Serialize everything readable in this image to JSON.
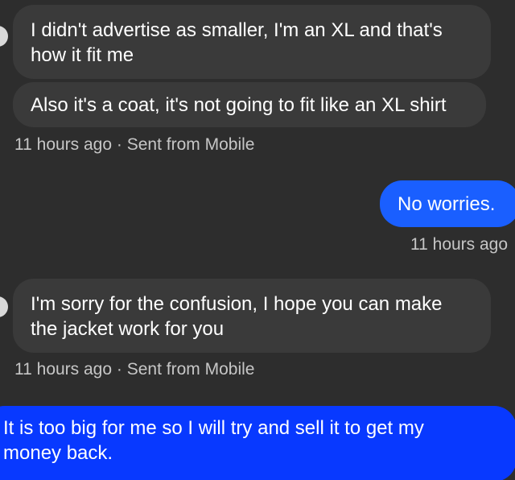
{
  "thread": {
    "messages": [
      {
        "direction": "incoming",
        "text": "I didn't advertise as smaller, I'm an XL and that's how it fit me"
      },
      {
        "direction": "incoming",
        "text": "Also it's a coat, it's not going to fit like an XL shirt"
      },
      {
        "direction": "incoming_meta",
        "time": "11 hours ago",
        "sep": "·",
        "source": "Sent from Mobile"
      },
      {
        "direction": "outgoing",
        "text": "No worries."
      },
      {
        "direction": "outgoing_meta",
        "time": "11 hours ago"
      },
      {
        "direction": "incoming",
        "text": "I'm sorry for the confusion, I hope you can make the jacket work for you"
      },
      {
        "direction": "incoming_meta",
        "time": "11 hours ago",
        "sep": "·",
        "source": "Sent from Mobile"
      },
      {
        "direction": "outgoing",
        "text": "It is too big for me so I will try and sell it to get my money back."
      }
    ]
  },
  "colors": {
    "background": "#2d2d2d",
    "incoming_bubble": "#3a3a3a",
    "outgoing_bubble_1": "#1a5fff",
    "outgoing_bubble_2": "#0839ff",
    "meta_text": "#c6c6c6",
    "message_text": "#ffffff"
  }
}
